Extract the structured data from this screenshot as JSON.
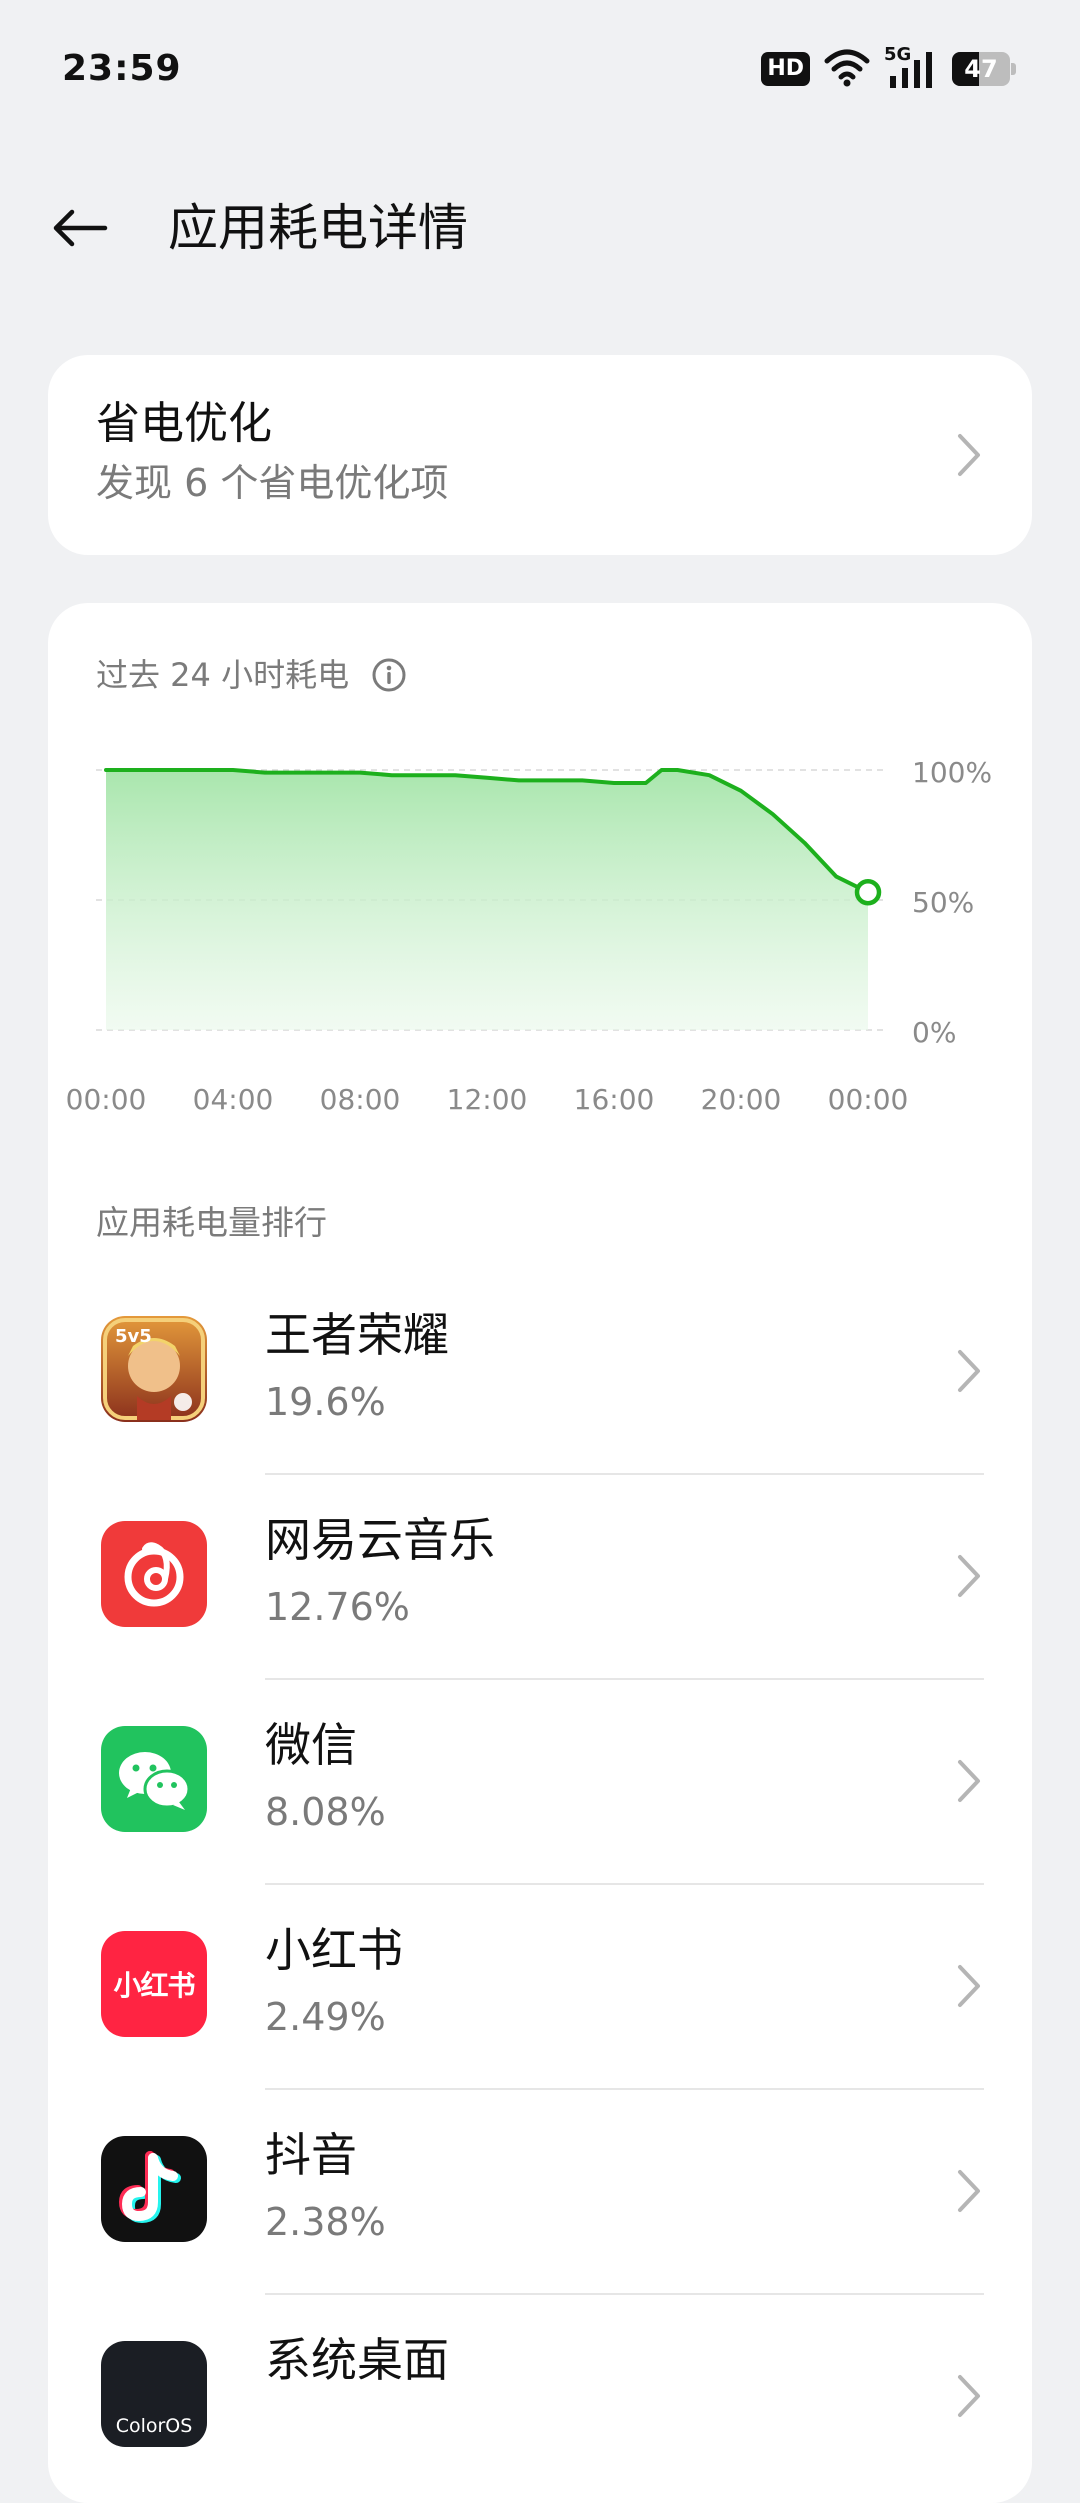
{
  "status_bar": {
    "time": "23:59",
    "hd": "HD",
    "network": "5G",
    "battery_level": "47",
    "battery_fraction": 0.47,
    "icons": [
      "hd-icon",
      "wifi-icon",
      "5g-signal-icon",
      "battery-icon"
    ]
  },
  "header": {
    "title": "应用耗电详情",
    "back_icon": "back-arrow-icon"
  },
  "power_saving": {
    "title": "省电优化",
    "subtitle": "发现 6 个省电优化项"
  },
  "chart_section": {
    "title": "过去 24 小时耗电"
  },
  "chart_data": {
    "type": "area",
    "title": "",
    "xlabel": "",
    "ylabel": "",
    "x_ticks": [
      "00:00",
      "04:00",
      "08:00",
      "12:00",
      "16:00",
      "20:00",
      "00:00"
    ],
    "y_ticks": [
      "100%",
      "50%",
      "0%"
    ],
    "ylim": [
      0,
      100
    ],
    "xlim": [
      0,
      24
    ],
    "grid": true,
    "series": [
      {
        "color": "#1db01d",
        "points": [
          [
            0,
            100
          ],
          [
            1,
            100
          ],
          [
            2,
            100
          ],
          [
            3,
            100
          ],
          [
            4,
            100
          ],
          [
            5,
            99
          ],
          [
            6,
            99
          ],
          [
            8,
            99
          ],
          [
            9,
            98
          ],
          [
            11,
            98
          ],
          [
            12,
            97
          ],
          [
            13,
            96
          ],
          [
            14,
            96
          ],
          [
            15,
            96
          ],
          [
            16,
            95
          ],
          [
            17,
            95
          ],
          [
            17.5,
            100
          ],
          [
            18,
            100
          ],
          [
            19,
            98
          ],
          [
            20,
            92
          ],
          [
            21,
            83
          ],
          [
            22,
            72
          ],
          [
            23,
            59
          ],
          [
            24,
            53
          ]
        ]
      }
    ]
  },
  "ranking": {
    "title": "应用耗电量排行",
    "apps": [
      {
        "name": "王者荣耀",
        "percent": "19.6%",
        "icon": "honor-of-kings-icon"
      },
      {
        "name": "网易云音乐",
        "percent": "12.76%",
        "icon": "netease-music-icon"
      },
      {
        "name": "微信",
        "percent": "8.08%",
        "icon": "wechat-icon"
      },
      {
        "name": "小红书",
        "percent": "2.49%",
        "icon": "xiaohongshu-icon",
        "icon_text": "小红书"
      },
      {
        "name": "抖音",
        "percent": "2.38%",
        "icon": "douyin-icon"
      },
      {
        "name": "系统桌面",
        "percent": "",
        "icon": "coloros-icon",
        "icon_text": "ColorOS"
      }
    ]
  },
  "colors": {
    "accent_green": "#1db01d",
    "background": "#f0f1f3",
    "card": "#ffffff",
    "secondary_text": "#7a7a7a"
  }
}
